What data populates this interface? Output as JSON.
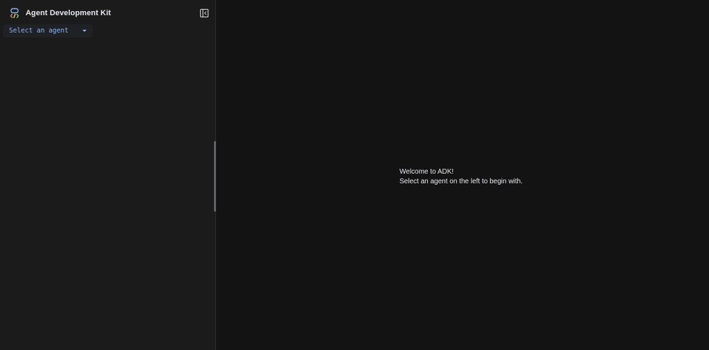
{
  "sidebar": {
    "app_title": "Agent Development Kit",
    "logo_icon": "adk-logo-icon",
    "collapse_icon": "sidebar-collapse-icon",
    "agent_select": {
      "placeholder": "Select an agent",
      "icon": "caret-down-icon"
    }
  },
  "main": {
    "welcome_title": "Welcome to ADK!",
    "welcome_subtitle": "Select an agent on the left to begin with."
  },
  "colors": {
    "background": "#131314",
    "sidebar": "#1b1b1c",
    "accent": "#8ab4f8",
    "text": "#e8eaed"
  }
}
